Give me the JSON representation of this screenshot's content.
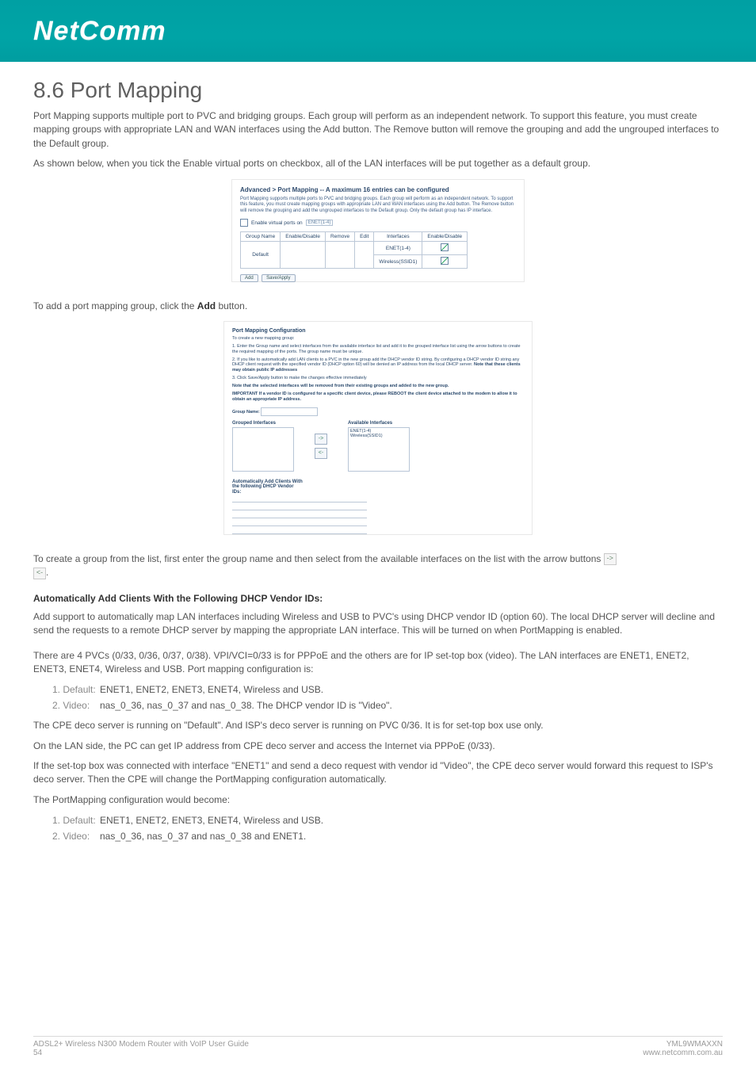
{
  "header": {
    "brand": "NetComm"
  },
  "heading": "8.6 Port Mapping",
  "para1": "Port Mapping supports multiple port to PVC and bridging groups. Each group will perform as an independent network. To support this feature, you must create mapping groups with appropriate LAN and WAN interfaces using the Add button. The Remove button will remove the grouping and add the ungrouped interfaces to the Default group.",
  "para2": "As shown below, when you tick the Enable virtual ports on checkbox, all of the LAN interfaces will be put together as a default group.",
  "shotA": {
    "title": "Advanced > Port Mapping -- A maximum 16 entries can be configured",
    "desc": "Port Mapping supports multiple ports to PVC and bridging groups. Each group will perform as an independent network. To support this feature, you must create mapping groups with appropriate LAN and WAN interfaces using the Add button. The Remove button will remove the grouping and add the ungrouped interfaces to the Default group. Only the default group has IP interface.",
    "checkbox": "Enable virtual ports on",
    "select": "ENET(1-4)",
    "cols": [
      "Group Name",
      "Enable/Disable",
      "Remove",
      "Edit",
      "Interfaces",
      "Enable/Disable"
    ],
    "group": "Default",
    "if1": "ENET(1-4)",
    "if2": "Wireless(SSID1)",
    "btnAdd": "Add",
    "btnSave": "Save/Apply"
  },
  "lineAdd_a": "To add a port mapping group, click the ",
  "lineAdd_b": "Add",
  "lineAdd_c": " button.",
  "shotB": {
    "title": "Port Mapping Configuration",
    "l1": "To create a new mapping group:",
    "l2": "1. Enter the Group name and select interfaces from the available interface list and add it to the grouped interface list using the arrow buttons to create the required mapping of the ports. The group name must be unique.",
    "l3": "2. If you like to automatically add LAN clients to a PVC in the new group add the DHCP vendor ID string. By configuring a DHCP vendor ID string any DHCP client request with the specified vendor ID (DHCP option 60) will be denied an IP address from the local DHCP server.",
    "l3b": "Note that these clients may obtain public IP addresses",
    "l4": "3. Click Save/Apply button to make the changes effective immediately",
    "note": "Note that the selected interfaces will be removed from their existing groups and added to the new group.",
    "imp": "IMPORTANT If a vendor ID is configured for a specific client device, please REBOOT the client device attached to the modem to allow it to obtain an appropriate IP address.",
    "groupLabel": "Group Name:",
    "colGrouped": "Grouped Interfaces",
    "colAvail": "Available Interfaces",
    "avail1": "ENET(1-4)",
    "avail2": "Wireless(SSID1)",
    "vendLabel": "Automatically Add Clients With the following DHCP Vendor IDs:"
  },
  "lineCreate_a": "To create a group from the list, first enter the group name and then select from the available interfaces on the list with the arrow buttons ",
  "lineCreate_b": ".",
  "autoHead": "Automatically Add Clients With the Following DHCP Vendor IDs:",
  "autoPara": "Add support to automatically map LAN interfaces including Wireless and USB to PVC's using DHCP vendor ID (option 60). The local DHCP server will decline and send the requests to a remote DHCP server by mapping the appropriate LAN interface. This will be turned on when PortMapping is enabled.",
  "pvcPara": "There are 4 PVCs (0/33, 0/36, 0/37, 0/38). VPI/VCI=0/33 is for PPPoE and the others are for IP set-top box (video). The LAN interfaces are ENET1, ENET2, ENET3, ENET4, Wireless and USB. Port mapping configuration is:",
  "list1": {
    "i1n": "1. Default:",
    "i1v": "ENET1, ENET2, ENET3, ENET4, Wireless and USB.",
    "i2n": "2. Video:",
    "i2v": "nas_0_36, nas_0_37 and nas_0_38. The DHCP vendor ID is \"Video\"."
  },
  "cpe": "The CPE deco server is running on \"Default\". And ISP's deco server is running on PVC 0/36. It is for set-top box use only.",
  "lan": "On the LAN side, the PC can get IP address from CPE deco server and access the Internet via PPPoE (0/33).",
  "stb": "If the set-top box was connected with interface \"ENET1\" and send a deco request with vendor id \"Video\", the CPE deco server would forward this request to ISP's deco server. Then the CPE will change the PortMapping configuration automatically.",
  "become": "The PortMapping configuration would become:",
  "list2": {
    "i1n": "1. Default:",
    "i1v": "ENET1, ENET2, ENET3, ENET4, Wireless and USB.",
    "i2n": "2. Video:",
    "i2v": "nas_0_36, nas_0_37 and nas_0_38 and ENET1."
  },
  "footer": {
    "leftTop": "ADSL2+ Wireless N300 Modem Router with VoIP User Guide",
    "leftBottom": "54",
    "rightTop": "YML9WMAXXN",
    "rightBottom": "www.netcomm.com.au"
  }
}
